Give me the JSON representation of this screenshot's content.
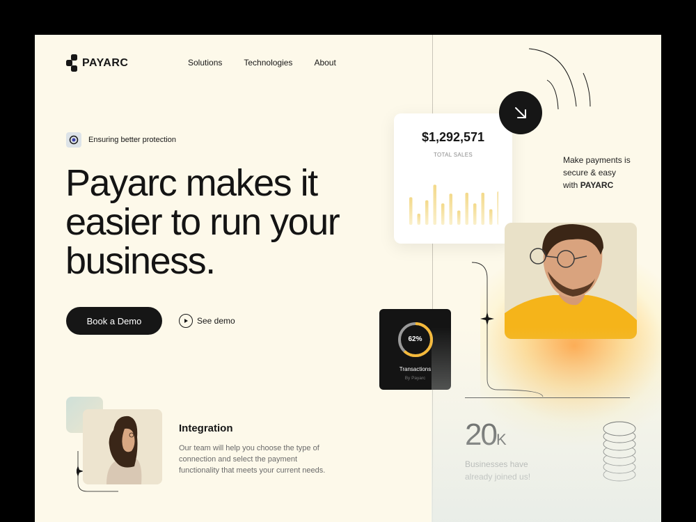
{
  "brand": {
    "name": "PAYARC"
  },
  "nav": {
    "items": [
      "Solutions",
      "Technologies",
      "About"
    ]
  },
  "badge": {
    "text": "Ensuring better protection"
  },
  "hero": {
    "title_line1": "Payarc makes it",
    "title_line2": "easier to run your",
    "title_line3": "business."
  },
  "cta": {
    "book_demo": "Book a Demo",
    "see_demo": "See demo"
  },
  "sales_card": {
    "amount": "$1,292,571",
    "label": "TOTAL SALES",
    "bars": [
      0.62,
      0.25,
      0.55,
      0.9,
      0.48,
      0.7,
      0.32,
      0.72,
      0.48,
      0.72,
      0.35,
      0.75
    ]
  },
  "secure": {
    "line1": "Make payments is",
    "line2": "secure & easy",
    "line3_prefix": "with",
    "line3_brand": "PAYARC"
  },
  "transactions": {
    "percent": "62%",
    "label": "Transactions",
    "sub": "By Payarc",
    "value": 0.62
  },
  "integration": {
    "title": "Integration",
    "text": "Our team will help you choose the type of connection and select the payment functionality that meets your current needs."
  },
  "stats": {
    "number": "20",
    "unit": "K",
    "line1": "Businesses have",
    "line2": "already joined us!"
  },
  "colors": {
    "dark": "#161616",
    "accent": "#f5b93a",
    "background": "#fdf9ea"
  },
  "icons": [
    "payarc-logo-icon",
    "eye-icon",
    "play-icon",
    "arrow-down-right-icon",
    "coin-stack-icon",
    "sparkle-icon"
  ]
}
